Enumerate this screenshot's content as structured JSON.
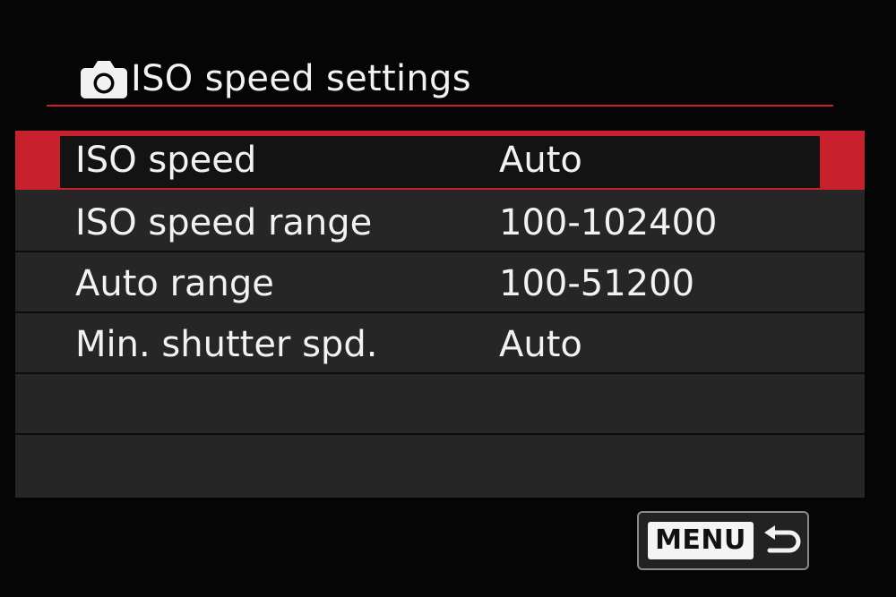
{
  "header": {
    "icon": "camera-icon",
    "title": "ISO speed settings"
  },
  "menu": {
    "items": [
      {
        "label": "ISO speed",
        "value": "Auto",
        "selected": true
      },
      {
        "label": "ISO speed range",
        "value": "100-102400",
        "selected": false
      },
      {
        "label": "Auto range",
        "value": "100-51200",
        "selected": false
      },
      {
        "label": "Min. shutter spd.",
        "value": "Auto",
        "selected": false
      },
      {
        "label": "",
        "value": "",
        "selected": false
      },
      {
        "label": "",
        "value": "",
        "selected": false
      }
    ]
  },
  "footer": {
    "menu_label": "MENU",
    "return_icon": "return-arrow-icon"
  },
  "colors": {
    "accent": "#c8202c",
    "background": "#050505",
    "row_background": "#262626",
    "text": "#f2f2f2"
  }
}
